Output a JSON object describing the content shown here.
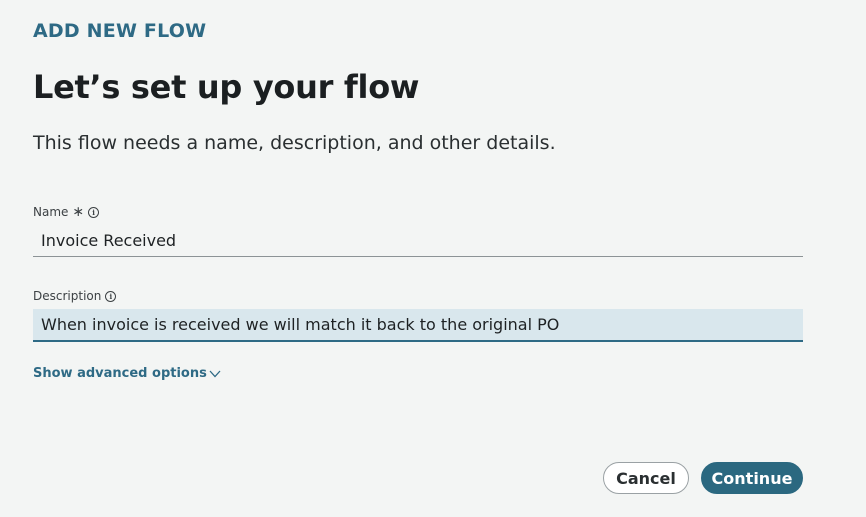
{
  "header": {
    "eyebrow": "ADD NEW FLOW",
    "title": "Let’s set up your flow",
    "subtitle": "This flow needs a name, description, and other details."
  },
  "form": {
    "name": {
      "label": "Name",
      "required_icon": "asterisk-icon",
      "info_icon": "info-icon",
      "value": "Invoice Received"
    },
    "description": {
      "label": "Description",
      "info_icon": "info-icon",
      "value": "When invoice is received we will match it back to the original PO"
    },
    "advanced_toggle": {
      "label": "Show advanced options",
      "icon": "chevron-down-icon"
    }
  },
  "actions": {
    "cancel_label": "Cancel",
    "continue_label": "Continue"
  },
  "colors": {
    "accent": "#2e6a85",
    "primary_button": "#2b6880",
    "focused_input_bg": "#d9e7ed",
    "page_bg": "#f3f5f4"
  }
}
